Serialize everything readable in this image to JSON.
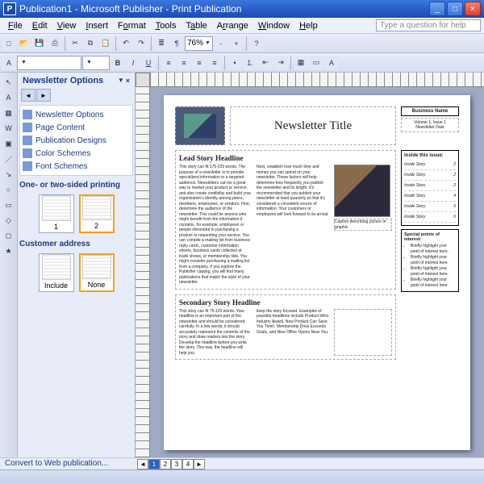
{
  "titlebar": {
    "title": "Publication1 - Microsoft Publisher - Print Publication"
  },
  "menubar": {
    "items": [
      "File",
      "Edit",
      "View",
      "Insert",
      "Format",
      "Tools",
      "Table",
      "Arrange",
      "Window",
      "Help"
    ],
    "help_placeholder": "Type a question for help"
  },
  "toolbar1": {
    "zoom": "76%"
  },
  "toolbar2": {
    "font": "",
    "size": ""
  },
  "taskpane": {
    "title": "Newsletter Options",
    "links": [
      {
        "label": "Newsletter Options",
        "icon": "doc"
      },
      {
        "label": "Page Content",
        "icon": "page"
      },
      {
        "label": "Publication Designs",
        "icon": "design"
      },
      {
        "label": "Color Schemes",
        "icon": "color"
      },
      {
        "label": "Font Schemes",
        "icon": "font"
      }
    ],
    "section1_title": "One- or two-sided printing",
    "thumbs1": [
      {
        "label": "1"
      },
      {
        "label": "2"
      }
    ],
    "section2_title": "Customer address",
    "thumbs2": [
      {
        "label": "Include"
      },
      {
        "label": "None"
      }
    ]
  },
  "newsletter": {
    "title": "Newsletter Title",
    "business": "Business Name",
    "meta1": "Volume 1, Issue 1",
    "meta2": "Newsletter Date",
    "lead_headline": "Lead Story Headline",
    "lead_col1": "This story can fit 175-225 words. The purpose of a newsletter is to provide specialized information to a targeted audience. Newsletters can be a great way to market your product or service, and also create credibility and build your organization's identity among peers, members, employees, or vendors. First, determine the audience of the newsletter. This could be anyone who might benefit from the information it contains, for example, employees or people interested in purchasing a product or requesting your service. You can compile a mailing list from business reply cards, customer information sheets, business cards collected at trade shows, or membership lists. You might consider purchasing a mailing list from a company. If you explore the Publisher catalog, you will find many publications that match the style of your newsletter.",
    "lead_col2": "Next, establish how much time and money you can spend on your newsletter. These factors will help determine how frequently you publish the newsletter and its length. It's recommended that you publish your newsletter at least quarterly so that it's considered a consistent source of information. Your customers or employees will look forward to its arrival.",
    "caption": "Caption describing picture or graphic.",
    "sec_headline": "Secondary Story Headline",
    "sec_col1": "This story can fit 75-125 words. Your headline is an important part of the newsletter and should be considered carefully. In a few words, it should accurately represent the contents of the story and draw readers into the story. Develop the headline before you write the story. This way, the headline will help you",
    "sec_col2": "keep the story focused. Examples of possible headlines include Product Wins Industry Award, New Product Can Save You Time!, Membership Drive Exceeds Goals, and New Office Opens Near You.",
    "inside_title": "Inside this issue:",
    "inside_items": [
      {
        "label": "Inside Story",
        "page": "2"
      },
      {
        "label": "Inside Story",
        "page": "2"
      },
      {
        "label": "Inside Story",
        "page": "2"
      },
      {
        "label": "Inside Story",
        "page": "4"
      },
      {
        "label": "Inside Story",
        "page": "5"
      },
      {
        "label": "Inside Story",
        "page": "6"
      }
    ],
    "points_title": "Special points of interest:",
    "points": [
      "Briefly highlight your point of interest here.",
      "Briefly highlight your point of interest here.",
      "Briefly highlight your point of interest here.",
      "Briefly highlight your point of interest here."
    ]
  },
  "convert": {
    "label": "Convert to Web publication..."
  },
  "pagenav": {
    "pages": [
      "1",
      "2",
      "3",
      "4"
    ]
  }
}
